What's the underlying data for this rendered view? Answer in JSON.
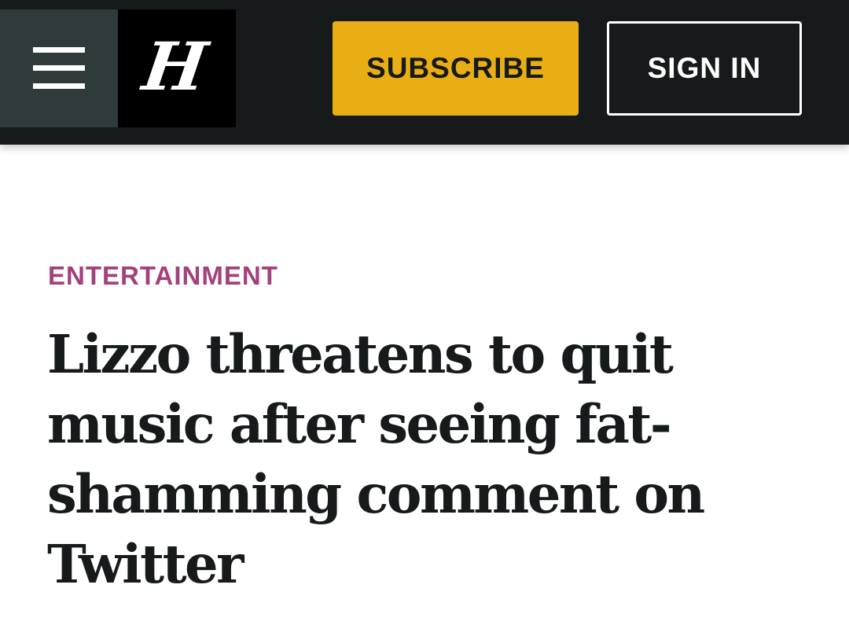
{
  "header": {
    "menu_icon": "hamburger-menu-icon",
    "logo": {
      "icon": "blackletter-h-logo",
      "glyph": "H"
    },
    "subscribe_label": "SUBSCRIBE",
    "sign_in_label": "SIGN IN",
    "colors": {
      "background": "#161a1b",
      "menu_background": "#2f3a3b",
      "subscribe_background": "#eaae15"
    }
  },
  "article": {
    "section": "ENTERTAINMENT",
    "section_color": "#a4407d",
    "headline": "Lizzo threatens to quit music after seeing fat-shamming comment on Twitter"
  }
}
